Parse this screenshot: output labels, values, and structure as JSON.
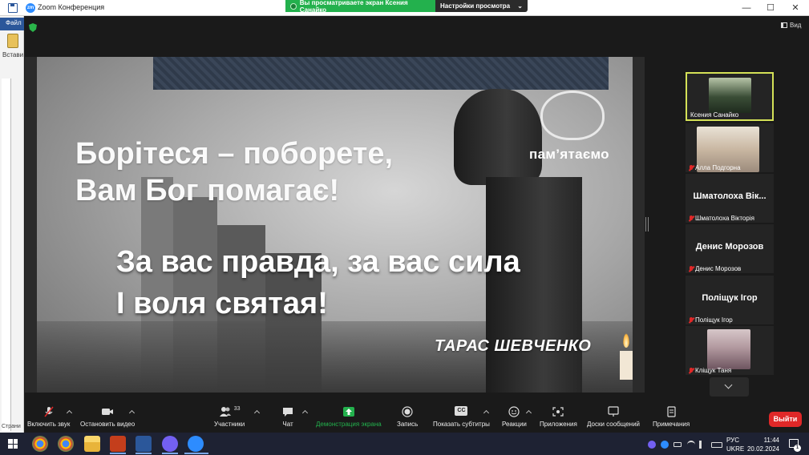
{
  "window": {
    "title": "Zoom Конференция",
    "zoom_logo_text": "zm",
    "minimize": "—",
    "maximize": "☐",
    "close": "✕"
  },
  "share_banner": {
    "message": "Вы просматриваете экран Ксения Санайко",
    "settings_label": "Настройки просмотра",
    "settings_chevron": "⌄",
    "color": "#23b14d"
  },
  "word_background": {
    "file_tab": "Файл",
    "paste_label": "Встави",
    "page_label": "Страни"
  },
  "meeting": {
    "view_label": "Вид",
    "security_color": "#2ab54a"
  },
  "slide": {
    "quote_line1": "Борітеся – поборете,",
    "quote_line2": "Вам Бог помагає!",
    "quote_line3": "За вас правда, за вас сила",
    "quote_line4": "І воля святая!",
    "author": "ТАРАС ШЕВЧЕНКО",
    "emblem_text": "пам’ятаємо"
  },
  "participants": [
    {
      "name": "Ксения Санайко",
      "video": true,
      "active": true,
      "muted": false
    },
    {
      "name": "Алла Подгорна",
      "video": true,
      "active": false,
      "muted": true
    },
    {
      "name": "Шматолоха Вікторія",
      "display_name": "Шматолоха Вік...",
      "video": false,
      "active": false,
      "muted": true
    },
    {
      "name": "Денис Морозов",
      "display_name": "Денис Морозов",
      "video": false,
      "active": false,
      "muted": true
    },
    {
      "name": "Поліщук Ігор",
      "display_name": "Поліщук Ігор",
      "video": false,
      "active": false,
      "muted": true
    },
    {
      "name": "Кліщук Таня",
      "video": true,
      "active": false,
      "muted": true
    }
  ],
  "toolbar": {
    "unmute": "Включить звук",
    "stop_video": "Остановить видео",
    "participants": "Участники",
    "participants_count": "33",
    "chat": "Чат",
    "share_screen": "Демонстрация экрана",
    "record": "Запись",
    "captions": "Показать субтитры",
    "captions_icon_text": "CC",
    "reactions": "Реакции",
    "apps": "Приложения",
    "whiteboards": "Доски сообщений",
    "notes": "Примечания",
    "leave": "Выйти",
    "share_color": "#23b14d",
    "leave_color": "#e02828"
  },
  "taskbar": {
    "apps": [
      "chrome-icon",
      "file-explorer-icon",
      "powerpoint-icon",
      "word-icon",
      "viber-icon",
      "zoom-icon"
    ],
    "lang_line1": "РУС",
    "lang_line2": "UKRE",
    "time": "11:44",
    "date": "20.02.2024",
    "notification_count": "1"
  }
}
